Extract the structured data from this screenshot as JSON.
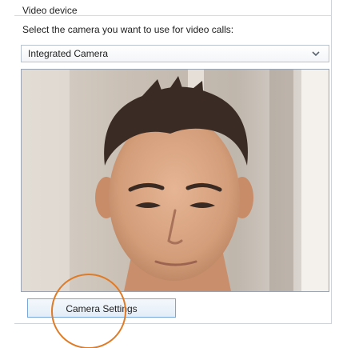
{
  "video_device": {
    "group_title": "Video device",
    "instruction": "Select the camera you want to use for video calls:",
    "camera_select": {
      "selected_value": "Integrated Camera",
      "icon": "chevron-down-icon"
    },
    "preview": {
      "content": "live webcam preview of a person"
    },
    "settings_button_label": "Camera Settings"
  },
  "annotation": {
    "highlight_color": "#e07a24"
  }
}
